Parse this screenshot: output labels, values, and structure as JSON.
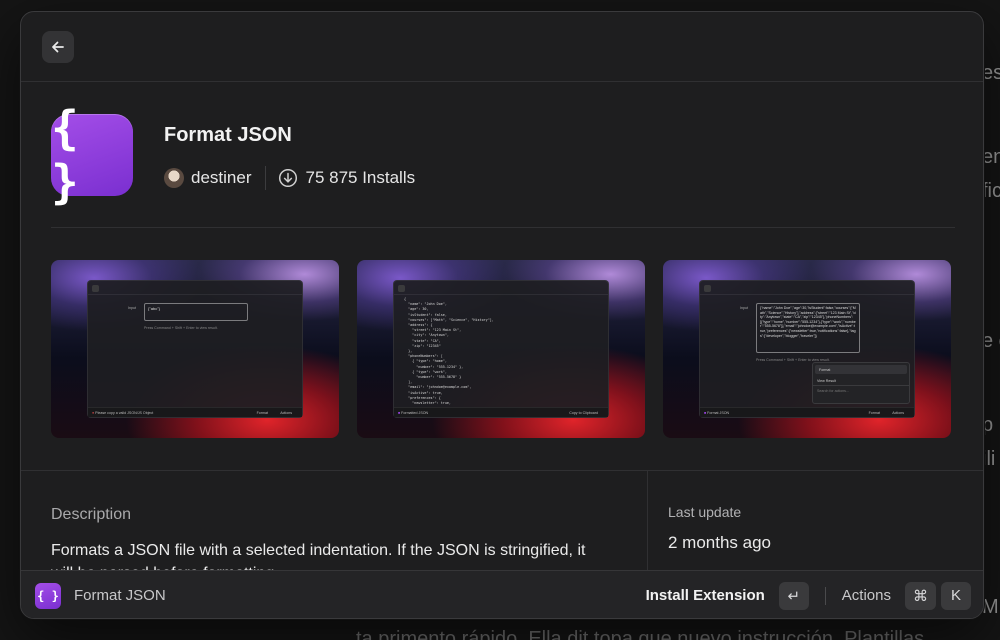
{
  "background": {
    "fragments": [
      {
        "text": "es"
      },
      {
        "text": "en"
      },
      {
        "text": "fic"
      },
      {
        "text": "e c"
      },
      {
        "text": "p"
      },
      {
        "text": "ili"
      },
      {
        "text": "ML"
      }
    ],
    "bottom_text": "ta primento rápido. Ella dit topa que nuevo instrucción. Plantillas"
  },
  "topbar": {
    "back_icon": "arrow-left-icon"
  },
  "extension": {
    "icon_glyph": "{ }",
    "title": "Format JSON",
    "author": "destiner",
    "installs": "75 875 Installs"
  },
  "screenshots": [
    {
      "input_label": "Input",
      "input_value": "{\"abc\"}",
      "hint": "Press Command + Shift + Enter to view result.",
      "footer_left": "Please copy a valid JSON/JS Object",
      "footer_primary": "Format",
      "footer_actions": "Actions"
    },
    {
      "code": "{\n  \"name\": \"John Doe\",\n  \"age\": 30,\n  \"isStudent\": false,\n  \"courses\": [\"Math\", \"Science\", \"History\"],\n  \"address\": {\n    \"street\": \"123 Main St\",\n    \"city\": \"Anytown\",\n    \"state\": \"CA\",\n    \"zip\": \"12345\"\n  },\n  \"phoneNumbers\": [\n    { \"type\": \"home\",\n      \"number\": \"555-1234\" },\n    { \"type\": \"work\",\n      \"number\": \"555-5678\" }\n  ],\n  \"email\": \"johndoe@example.com\",\n  \"isActive\": true,\n  \"preferences\": {\n    \"newsletter\": true,",
      "footer_left": "Formatted JSON",
      "footer_primary": "Copy to Clipboard"
    },
    {
      "input_label": "Input",
      "input_value": "{\"name\":\"John Doe\",\"age\":30,\"isStudent\":false,\"courses\":[\"Math\",\"Science\",\"History\"],\"address\":{\"street\":\"123 Main St\",\"city\":\"Anytown\",\"state\":\"CA\",\"zip\":\"12345\"},\"phoneNumbers\":[{\"type\":\"home\",\"number\":\"555-1234\"},{\"type\":\"work\",\"number\":\"555-5678\"}],\"email\":\"johndoe@example.com\",\"isActive\":true,\"preferences\":{\"newsletter\":true,\"notifications\":false},\"tags\":[\"developer\",\"blogger\",\"traveler\"]}",
      "hint": "Press Command + Shift + Enter to view result.",
      "menu_items": [
        "Format",
        "View Result"
      ],
      "menu_search": "Search for actions...",
      "footer_left": "Format JSON",
      "footer_primary": "Format",
      "footer_actions": "Actions"
    }
  ],
  "description": {
    "title": "Description",
    "text": "Formats a JSON file with a selected indentation. If the JSON is stringified, it will be parsed before formatting."
  },
  "last_update": {
    "title": "Last update",
    "value": "2 months ago"
  },
  "bottombar": {
    "icon_glyph": "{ }",
    "title": "Format JSON",
    "primary_action": "Install Extension",
    "enter_key": "↵",
    "actions_label": "Actions",
    "cmd_key": "⌘",
    "k_key": "K"
  },
  "colors": {
    "accent_purple": "#9b45e4",
    "window_bg": "#1e1e1f",
    "bar_bg": "#242426"
  }
}
